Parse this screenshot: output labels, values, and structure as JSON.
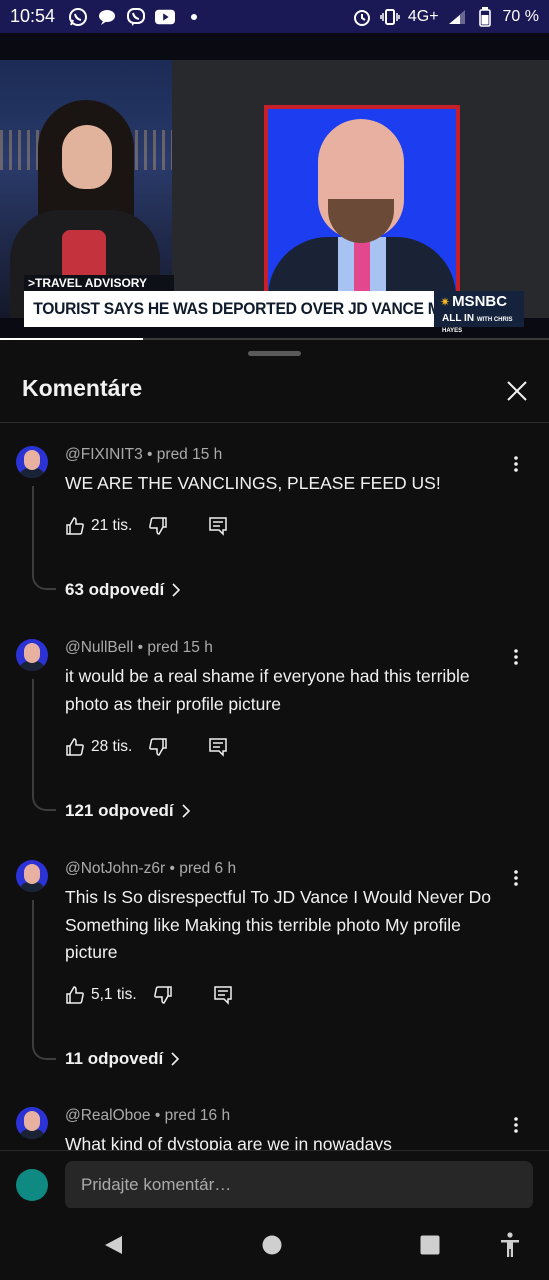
{
  "status_bar": {
    "time": "10:54",
    "network": "4G+",
    "battery": "70 %",
    "icons": [
      "whatsapp-icon",
      "chat-bubble-icon",
      "viber-icon",
      "youtube-icon",
      "dot-icon",
      "alarm-icon",
      "vibrate-icon",
      "signal-icon",
      "battery-icon"
    ]
  },
  "video": {
    "tag": ">TRAVEL ADVISORY",
    "headline": "TOURIST SAYS HE WAS DEPORTED OVER JD VANCE MEME",
    "network_logo": "MSNBC",
    "show": "ALL IN",
    "show_sub": "WITH CHRIS HAYES",
    "progress": 0.26
  },
  "panel": {
    "title": "Komentáre",
    "close_icon": "close-icon"
  },
  "comments": [
    {
      "meta": "@FIXINIT3 • pred 15 h",
      "text": "WE ARE THE VANCLINGS, PLEASE FEED US!",
      "likes": "21 tis.",
      "replies": "63 odpovedí"
    },
    {
      "meta": "@NullBell • pred 15 h",
      "text": "it would be a real shame if everyone had this terrible photo as their profile picture",
      "likes": "28 tis.",
      "replies": "121 odpovedí"
    },
    {
      "meta": "@NotJohn-z6r • pred 6 h",
      "text": "This Is So disrespectful To JD Vance I Would Never Do Something like Making this terrible photo My profile picture",
      "likes": "5,1 tis.",
      "replies": "11 odpovedí"
    },
    {
      "meta": "@RealOboe • pred 16 h",
      "text": "What kind of dystopia are we in nowadays"
    }
  ],
  "input": {
    "placeholder": "Pridajte komentár…"
  },
  "colors": {
    "status_bar_bg": "#1b1856",
    "panel_bg": "#0f0f0f",
    "input_bg": "#272727",
    "user_avatar": "#0e8a82"
  }
}
